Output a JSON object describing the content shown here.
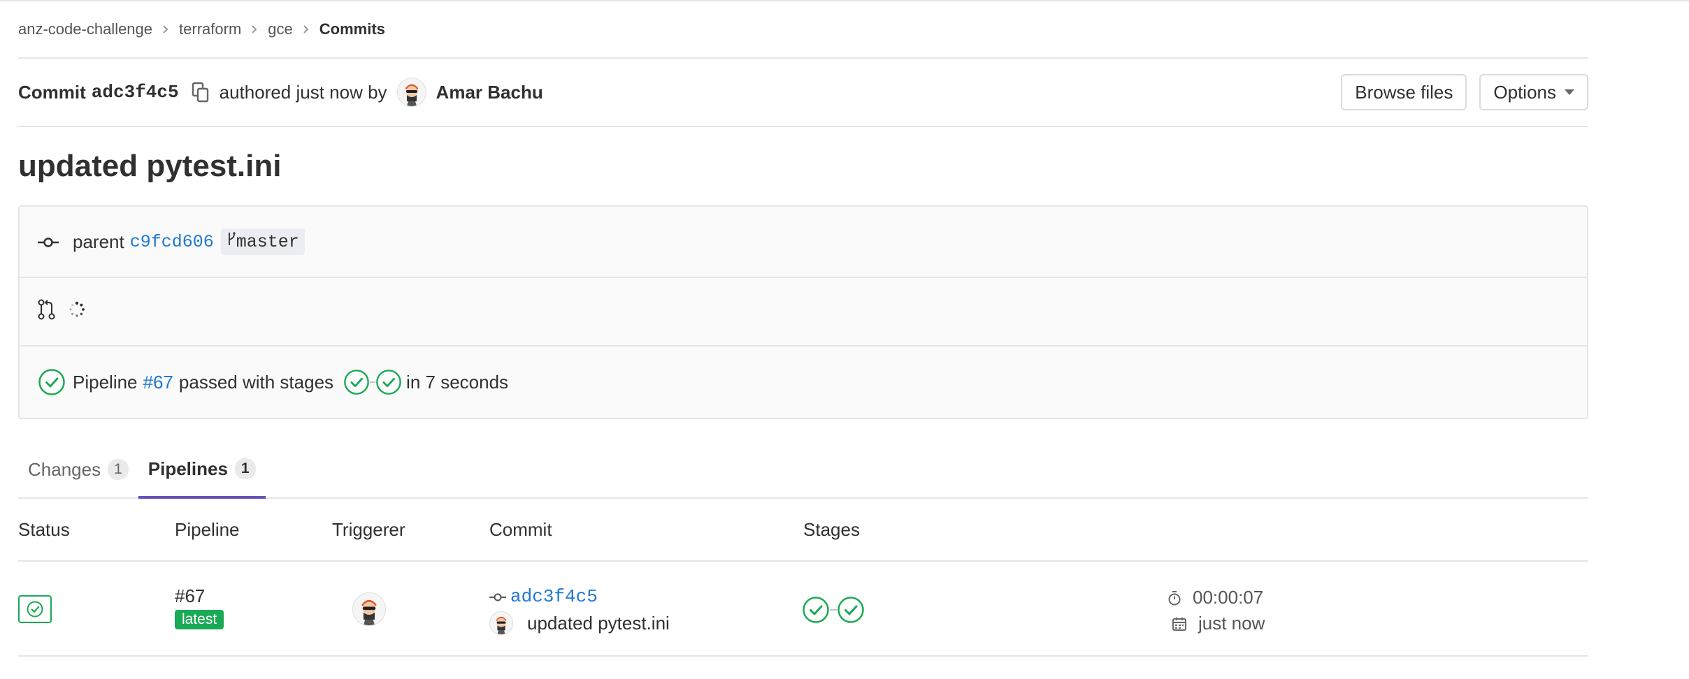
{
  "breadcrumb": {
    "items": [
      "anz-code-challenge",
      "terraform",
      "gce"
    ],
    "current": "Commits"
  },
  "commit": {
    "label": "Commit",
    "sha_short": "adc3f4c5",
    "authored_text": "authored just now by",
    "author_name": "Amar Bachu",
    "title": "updated pytest.ini"
  },
  "actions": {
    "browse_files": "Browse files",
    "options": "Options"
  },
  "info": {
    "parent_label": "parent",
    "parent_sha": "c9fcd606",
    "branch": "master",
    "pipeline_prefix": "Pipeline",
    "pipeline_id": "#67",
    "pipeline_status_text": "passed with stages",
    "duration_text": "in 7 seconds"
  },
  "tabs": [
    {
      "label": "Changes",
      "count": "1",
      "active": false
    },
    {
      "label": "Pipelines",
      "count": "1",
      "active": true
    }
  ],
  "table": {
    "headers": {
      "status": "Status",
      "pipeline": "Pipeline",
      "triggerer": "Triggerer",
      "commit": "Commit",
      "stages": "Stages"
    },
    "rows": [
      {
        "pipeline_id": "#67",
        "badge": "latest",
        "commit_sha": "adc3f4c5",
        "commit_title": "updated pytest.ini",
        "duration": "00:00:07",
        "finished": "just now"
      }
    ]
  },
  "colors": {
    "success": "#1aaa55",
    "link": "#1f78d1",
    "active_tab": "#6b4fbb"
  },
  "icons": [
    "copy-icon",
    "commit-icon",
    "branch-icon",
    "merge-request-icon",
    "loading-spinner-icon",
    "status-success-icon",
    "timer-icon",
    "calendar-icon"
  ]
}
